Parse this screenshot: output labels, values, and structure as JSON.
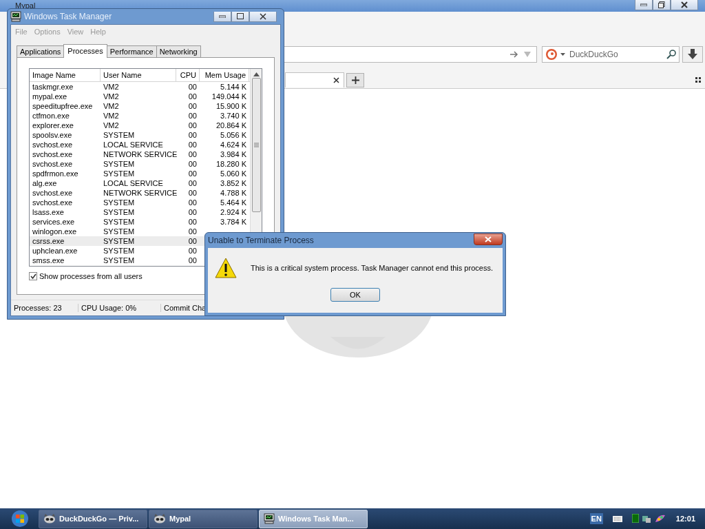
{
  "browser": {
    "title": "Mypal",
    "search": {
      "placeholder": "DuckDuckGo"
    }
  },
  "task_manager": {
    "title": "Windows Task Manager",
    "menu": [
      "File",
      "Options",
      "View",
      "Help"
    ],
    "tabs": [
      {
        "label": "Applications",
        "selected": false
      },
      {
        "label": "Processes",
        "selected": true
      },
      {
        "label": "Performance",
        "selected": false
      },
      {
        "label": "Networking",
        "selected": false
      }
    ],
    "columns": [
      "Image Name",
      "User Name",
      "CPU",
      "Mem Usage"
    ],
    "rows": [
      {
        "image": "taskmgr.exe",
        "user": "VM2",
        "cpu": "00",
        "mem": "5.144 K",
        "selected": false
      },
      {
        "image": "mypal.exe",
        "user": "VM2",
        "cpu": "00",
        "mem": "149.044 K",
        "selected": false
      },
      {
        "image": "speeditupfree.exe",
        "user": "VM2",
        "cpu": "00",
        "mem": "15.900 K",
        "selected": false
      },
      {
        "image": "ctfmon.exe",
        "user": "VM2",
        "cpu": "00",
        "mem": "3.740 K",
        "selected": false
      },
      {
        "image": "explorer.exe",
        "user": "VM2",
        "cpu": "00",
        "mem": "20.864 K",
        "selected": false
      },
      {
        "image": "spoolsv.exe",
        "user": "SYSTEM",
        "cpu": "00",
        "mem": "5.056 K",
        "selected": false
      },
      {
        "image": "svchost.exe",
        "user": "LOCAL SERVICE",
        "cpu": "00",
        "mem": "4.624 K",
        "selected": false
      },
      {
        "image": "svchost.exe",
        "user": "NETWORK SERVICE",
        "cpu": "00",
        "mem": "3.984 K",
        "selected": false
      },
      {
        "image": "svchost.exe",
        "user": "SYSTEM",
        "cpu": "00",
        "mem": "18.280 K",
        "selected": false
      },
      {
        "image": "spdfrmon.exe",
        "user": "SYSTEM",
        "cpu": "00",
        "mem": "5.060 K",
        "selected": false
      },
      {
        "image": "alg.exe",
        "user": "LOCAL SERVICE",
        "cpu": "00",
        "mem": "3.852 K",
        "selected": false
      },
      {
        "image": "svchost.exe",
        "user": "NETWORK SERVICE",
        "cpu": "00",
        "mem": "4.788 K",
        "selected": false
      },
      {
        "image": "svchost.exe",
        "user": "SYSTEM",
        "cpu": "00",
        "mem": "5.464 K",
        "selected": false
      },
      {
        "image": "lsass.exe",
        "user": "SYSTEM",
        "cpu": "00",
        "mem": "2.924 K",
        "selected": false
      },
      {
        "image": "services.exe",
        "user": "SYSTEM",
        "cpu": "00",
        "mem": "3.784 K",
        "selected": false
      },
      {
        "image": "winlogon.exe",
        "user": "SYSTEM",
        "cpu": "00",
        "selected": false
      },
      {
        "image": "csrss.exe",
        "user": "SYSTEM",
        "cpu": "00",
        "selected": true
      },
      {
        "image": "uphclean.exe",
        "user": "SYSTEM",
        "cpu": "00",
        "selected": false
      },
      {
        "image": "smss.exe",
        "user": "SYSTEM",
        "cpu": "00",
        "selected": false
      }
    ],
    "show_all_users": {
      "label": "Show processes from all users",
      "checked": true
    },
    "status_bar": [
      "Processes: 23",
      "CPU Usage: 0%",
      "Commit Cha"
    ]
  },
  "dialog": {
    "title": "Unable to Terminate Process",
    "message": "This is a critical system process.  Task Manager cannot end this process.",
    "button": "OK"
  },
  "taskbar": {
    "items": [
      {
        "label": "DuckDuckGo — Priv...",
        "kind": "browser",
        "selected": false
      },
      {
        "label": "Mypal",
        "kind": "browser",
        "selected": false
      },
      {
        "label": "Windows Task Man...",
        "kind": "taskmgr",
        "selected": true
      }
    ],
    "language": "EN",
    "clock": "12:01"
  }
}
